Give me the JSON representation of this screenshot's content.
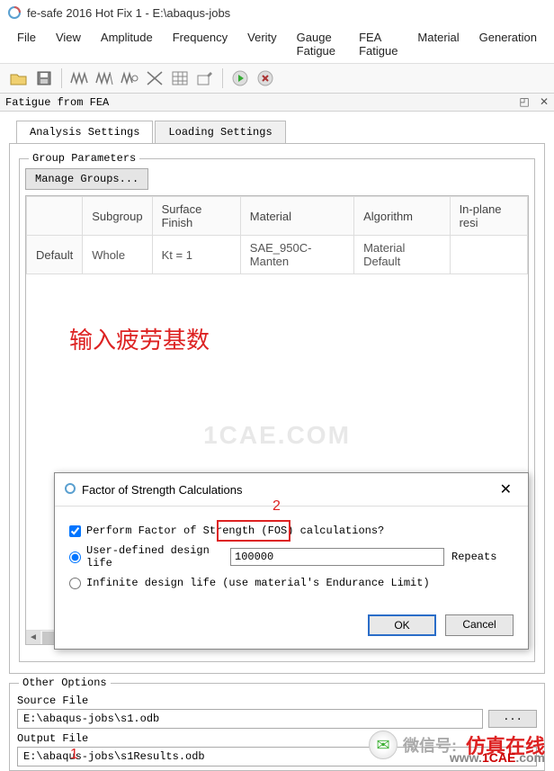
{
  "window": {
    "title": "fe-safe 2016 Hot Fix 1 - E:\\abaqus-jobs"
  },
  "menu": [
    "File",
    "View",
    "Amplitude",
    "Frequency",
    "Verity",
    "Gauge Fatigue",
    "FEA Fatigue",
    "Material",
    "Generation"
  ],
  "panel": {
    "title": "Fatigue from FEA"
  },
  "tabs": {
    "analysis": "Analysis Settings",
    "loading": "Loading Settings"
  },
  "group": {
    "legend": "Group Parameters",
    "manage": "Manage Groups...",
    "headers": [
      "",
      "Subgroup",
      "Surface Finish",
      "Material",
      "Algorithm",
      "In-plane resi"
    ],
    "row": [
      "Default",
      "Whole",
      "Kt = 1",
      "SAE_950C-Manten",
      "Material Default",
      ""
    ]
  },
  "annotation": {
    "text": "输入疲劳基数",
    "watermark": "1CAE.COM",
    "num2": "2",
    "num1": "1"
  },
  "dialog": {
    "title": "Factor of Strength Calculations",
    "perform": "Perform Factor of Strength (FOS) calculations?",
    "user_defined": "User-defined design life",
    "life_value": "100000",
    "repeats": "Repeats",
    "infinite": "Infinite design life (use material's Endurance Limit)",
    "ok": "OK",
    "cancel": "Cancel"
  },
  "other": {
    "legend": "Other Options",
    "source_label": "Source File",
    "source_value": "E:\\abaqus-jobs\\s1.odb",
    "output_label": "Output File",
    "output_value": "E:\\abaqus-jobs\\s1Results.odb",
    "browse": "..."
  },
  "footer": {
    "wechat": "微信号:",
    "brand": "仿真在线",
    "url_pre": "www.",
    "url_main": "1CAE",
    "url_post": ".com"
  }
}
